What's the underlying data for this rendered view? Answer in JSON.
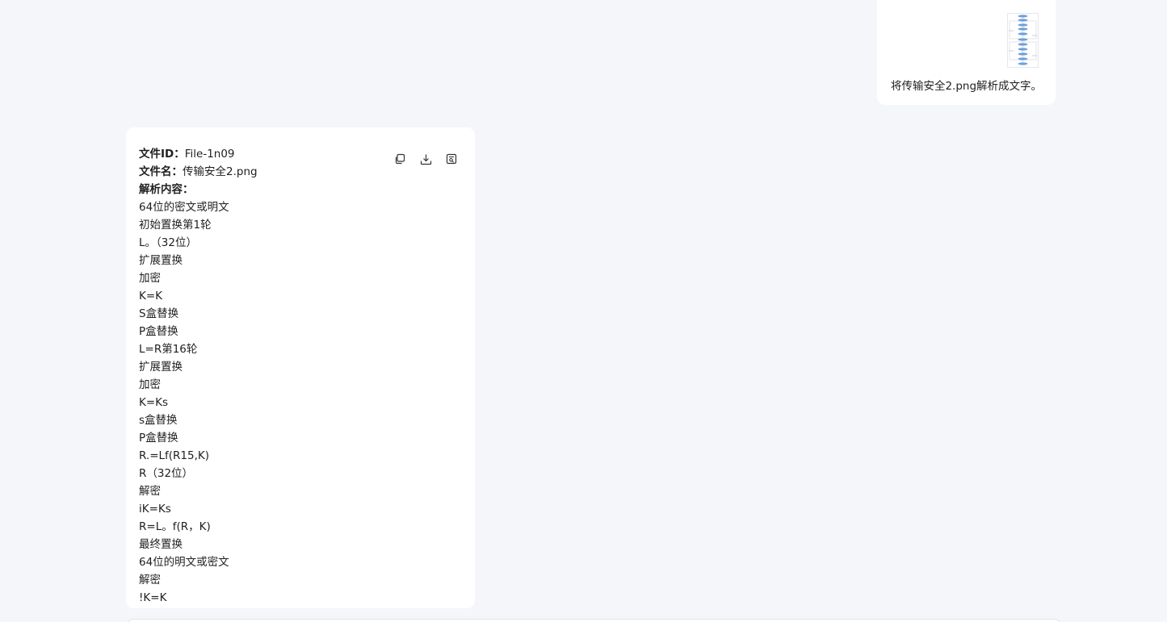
{
  "user_message": {
    "text": "将传输安全2.png解析成文字。",
    "attachment_icon": "flowchart-thumbnail"
  },
  "reply": {
    "toolbar": {
      "copy_icon": "copy-icon",
      "download_icon": "download-icon",
      "export_icon": "export-icon"
    },
    "file_id_label": "文件ID：",
    "file_id_value": "File-1n09",
    "file_name_label": "文件名：",
    "file_name_value": "传输安全2.png",
    "parsed_label": "解析内容：",
    "lines": [
      "64位的密文或明文",
      "初始置换第1轮",
      "L。（32位）",
      "扩展置换",
      "加密",
      "K=K",
      "S盒替换",
      "P盒替换",
      "L=R第16轮",
      "扩展置换",
      "加密",
      "K=Ks",
      "s盒替换",
      "P盒替换",
      "R.=Lf(R15,K)",
      "R（32位）",
      "解密",
      "iK=Ks",
      "R=L。f(R，K)",
      "最终置换",
      "64位的明文或密文",
      "解密",
      "!K=K"
    ]
  }
}
